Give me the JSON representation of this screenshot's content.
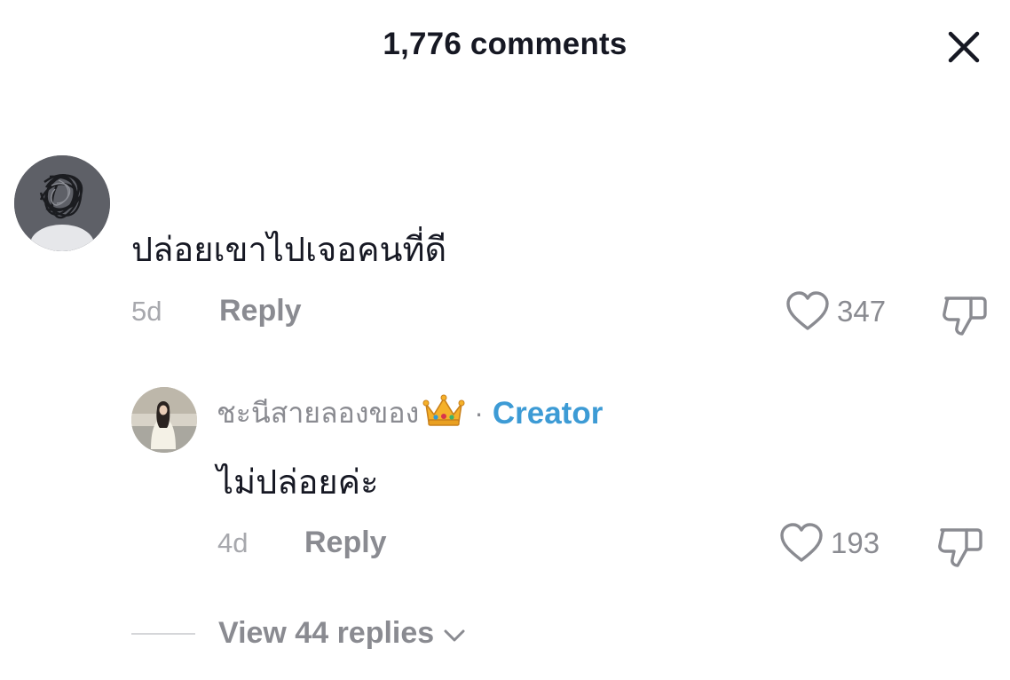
{
  "header": {
    "title": "1,776 comments",
    "close_icon": "close-icon"
  },
  "comments": [
    {
      "avatar": "scribbled-avatar",
      "text": "ปล่อยเขาไปเจอคนที่ดี",
      "time": "5d",
      "reply_label": "Reply",
      "like_count": "347"
    }
  ],
  "replies": [
    {
      "avatar": "photo-avatar",
      "username": "ชะนีสายลองของ",
      "username_badge": "crown-emoji",
      "separator": "·",
      "creator_label": "Creator",
      "text": "ไม่ปล่อยค่ะ",
      "time": "4d",
      "reply_label": "Reply",
      "like_count": "193"
    }
  ],
  "view_replies": {
    "label": "View 44 replies"
  },
  "colors": {
    "text_primary": "#161823",
    "text_secondary": "#8a8b91",
    "creator_accent": "#3d9bd5"
  }
}
